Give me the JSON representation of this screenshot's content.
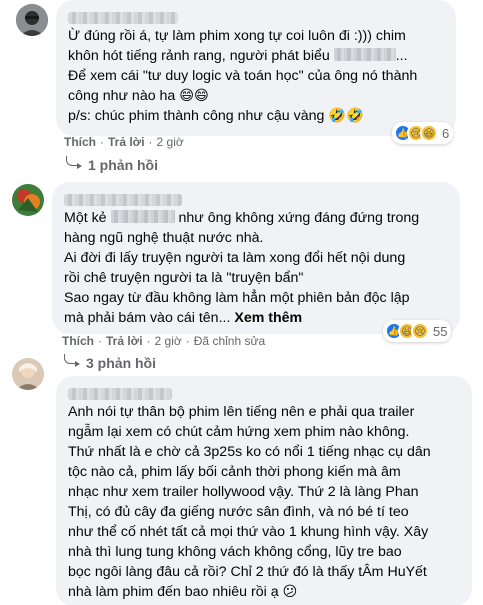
{
  "colors": {
    "bubble": "#f0f2f5",
    "meta": "#65676b",
    "like": "#1877f2",
    "haha": "#f7c02d",
    "text": "#050505"
  },
  "comments": [
    {
      "lines": [
        {
          "before": "Ừ đúng rồi á, tự làm phim xong tự coi luôn đi :))) chim"
        },
        {
          "before": "khôn hót tiếng rảnh rang, người phát biểu",
          "after": "..."
        },
        {
          "before": "Để xem cái \"tư duy logic và toán học\" của ông nó thành"
        },
        {
          "before": "công như nào ha 😄😄"
        },
        {
          "before": "p/s: chúc phim thành công như cậu vàng 🤣🤣"
        }
      ],
      "actions": {
        "like": "Thích",
        "reply": "Trả lời",
        "time": "2 giờ"
      },
      "reactions": {
        "count": "6",
        "icons": [
          "like-icon",
          "sad-icon",
          "haha-icon"
        ]
      },
      "replies": "1 phản hồi"
    },
    {
      "lines": [
        {
          "before": "Một kẻ",
          "after": "như ông không xứng đáng đứng trong"
        },
        {
          "before": "hàng ngũ nghệ thuật nước nhà."
        },
        {
          "before": "Ai đời đi lấy truyện người ta làm xong đổi hết nội dung"
        },
        {
          "before": "rồi chê truyện người ta là \"truyện bẩn\""
        },
        {
          "before": "Sao ngay từ đầu không làm hẳn một phiên bản độc lập"
        },
        {
          "before": "mà phải bám vào cái tên...",
          "seemore": "Xem thêm"
        }
      ],
      "actions": {
        "like": "Thích",
        "reply": "Trả lời",
        "time": "2 giờ",
        "edited": "Đã chỉnh sửa"
      },
      "reactions": {
        "count": "55",
        "icons": [
          "like-icon",
          "haha-icon",
          "sad-icon"
        ]
      },
      "replies": "3 phản hồi"
    },
    {
      "lines": [
        {
          "before": "Anh nói tự thân bộ phim lên tiếng nên e phải qua trailer"
        },
        {
          "before": "ngẫm lại xem có chút cảm hứng xem phim nào không."
        },
        {
          "before": "Thứ nhất là e chờ cả 3p25s ko có nổi 1 tiếng nhạc cụ dân"
        },
        {
          "before": "tộc nào cả, phim lấy bối cảnh thời phong kiến mà âm"
        },
        {
          "before": "nhạc như xem trailer hollywood vậy. Thứ 2 là làng Phan"
        },
        {
          "before": "Thị, có đủ cây đa giếng nước sân đình, và nó bé tí teo"
        },
        {
          "before": "như thể cố nhét tất cả mọi thứ vào 1 khung hình vậy. Xây"
        },
        {
          "before": "nhà thì lung tung không vách không cổng, lũy tre bao"
        },
        {
          "before": "bọc ngôi làng đâu cả rồi? Chỉ 2 thứ đó là thấy tÂm HuYết"
        },
        {
          "before": "nhà làm phim đến bao nhiêu rồi ạ 😕"
        }
      ]
    }
  ],
  "separator": "·"
}
